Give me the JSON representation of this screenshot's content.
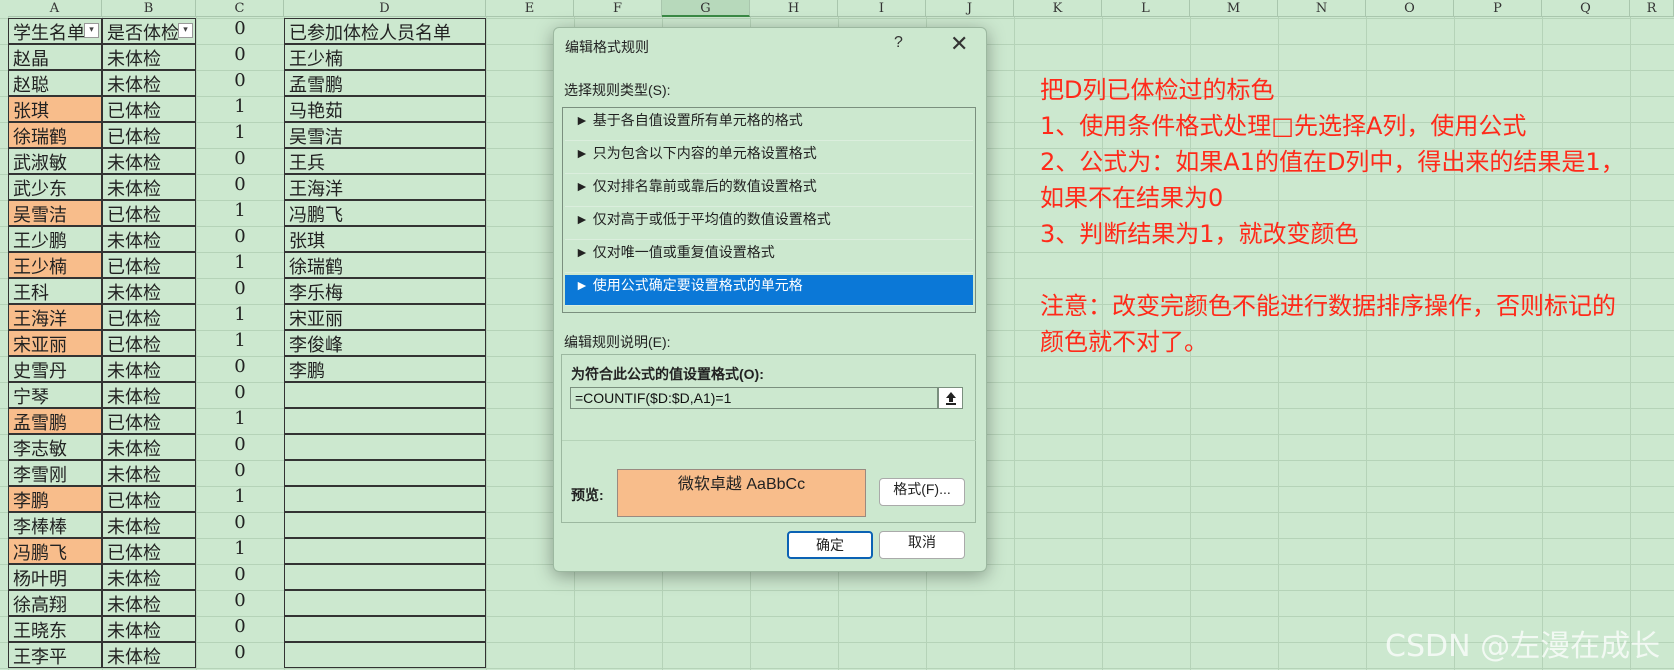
{
  "columns": [
    "A",
    "B",
    "C",
    "D",
    "E",
    "F",
    "G",
    "H",
    "I",
    "J",
    "K",
    "L",
    "M",
    "N",
    "O",
    "P",
    "Q",
    "R"
  ],
  "header_row": {
    "a": "学生名单",
    "b": "是否体检",
    "c": "0",
    "d": "已参加体检人员名单"
  },
  "rows": [
    {
      "a": "赵晶",
      "b": "未体检",
      "c": "0",
      "d": "王少楠"
    },
    {
      "a": "赵聪",
      "b": "未体检",
      "c": "0",
      "d": "孟雪鹏"
    },
    {
      "a": "张琪",
      "b": "已体检",
      "c": "1",
      "d": "马艳茹"
    },
    {
      "a": "徐瑞鹤",
      "b": "已体检",
      "c": "1",
      "d": "吴雪洁"
    },
    {
      "a": "武淑敏",
      "b": "未体检",
      "c": "0",
      "d": "王兵"
    },
    {
      "a": "武少东",
      "b": "未体检",
      "c": "0",
      "d": "王海洋"
    },
    {
      "a": "吴雪洁",
      "b": "已体检",
      "c": "1",
      "d": "冯鹏飞"
    },
    {
      "a": "王少鹏",
      "b": "未体检",
      "c": "0",
      "d": "张琪"
    },
    {
      "a": "王少楠",
      "b": "已体检",
      "c": "1",
      "d": "徐瑞鹤"
    },
    {
      "a": "王科",
      "b": "未体检",
      "c": "0",
      "d": "李乐梅"
    },
    {
      "a": "王海洋",
      "b": "已体检",
      "c": "1",
      "d": "宋亚丽"
    },
    {
      "a": "宋亚丽",
      "b": "已体检",
      "c": "1",
      "d": "李俊峰"
    },
    {
      "a": "史雪丹",
      "b": "未体检",
      "c": "0",
      "d": "李鹏"
    },
    {
      "a": "宁琴",
      "b": "未体检",
      "c": "0",
      "d": ""
    },
    {
      "a": "孟雪鹏",
      "b": "已体检",
      "c": "1",
      "d": ""
    },
    {
      "a": "李志敏",
      "b": "未体检",
      "c": "0",
      "d": ""
    },
    {
      "a": "李雪刚",
      "b": "未体检",
      "c": "0",
      "d": ""
    },
    {
      "a": "李鹏",
      "b": "已体检",
      "c": "1",
      "d": ""
    },
    {
      "a": "李棒棒",
      "b": "未体检",
      "c": "0",
      "d": ""
    },
    {
      "a": "冯鹏飞",
      "b": "已体检",
      "c": "1",
      "d": ""
    },
    {
      "a": "杨叶明",
      "b": "未体检",
      "c": "0",
      "d": ""
    },
    {
      "a": "徐高翔",
      "b": "未体检",
      "c": "0",
      "d": ""
    },
    {
      "a": "王晓东",
      "b": "未体检",
      "c": "0",
      "d": ""
    },
    {
      "a": "王李平",
      "b": "未体检",
      "c": "0",
      "d": ""
    }
  ],
  "highlight_color": "#f8bd8b",
  "selected_column": "G",
  "dialog": {
    "title": "编辑格式规则",
    "help": "?",
    "close": "✕",
    "select_rule_label": "选择规则类型(S):",
    "rule_types": [
      "► 基于各自值设置所有单元格的格式",
      "► 只为包含以下内容的单元格设置格式",
      "► 仅对排名靠前或靠后的数值设置格式",
      "► 仅对高于或低于平均值的数值设置格式",
      "► 仅对唯一值或重复值设置格式",
      "► 使用公式确定要设置格式的单元格"
    ],
    "selected_rule_index": 5,
    "edit_desc_label": "编辑规则说明(E):",
    "formula_label": "为符合此公式的值设置格式(O):",
    "formula": "=COUNTIF($D:$D,A1)=1",
    "preview_label": "预览:",
    "preview_text": "微软卓越  AaBbCc",
    "format_button": "格式(F)...",
    "ok_button": "确定",
    "cancel_button": "取消"
  },
  "notes": [
    "把D列已体检过的标色",
    "1、使用条件格式处理□先选择A列，使用公式",
    "2、公式为：如果A1的值在D列中，得出来的结果是1，",
    "如果不在结果为0",
    "3、判断结果为1，就改变颜色",
    "",
    "注意：改变完颜色不能进行数据排序操作，否则标记的",
    "颜色就不对了。"
  ],
  "watermark": "CSDN @左漫在成长",
  "note_color": "#ff2a1a"
}
